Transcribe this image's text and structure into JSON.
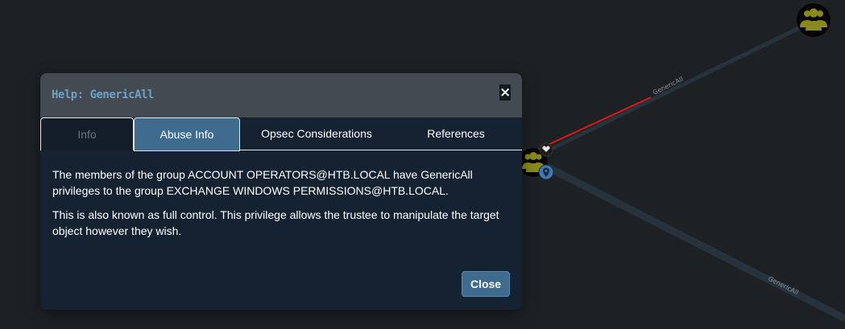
{
  "graph": {
    "edge_label_1": "GenericAll",
    "edge_label_2": "GenericAll",
    "colors": {
      "background": "#1e2124",
      "edge": "#26323c",
      "group_node": "#8a8a1c",
      "highlight_arrow": "#e01616",
      "pin_badge": "#3e78b2"
    },
    "icons": [
      "group-icon",
      "crown-icon",
      "map-pin-icon"
    ]
  },
  "modal": {
    "title": "Help: GenericAll",
    "close_icon": "×",
    "tabs": [
      "Info",
      "Abuse Info",
      "Opsec Considerations",
      "References"
    ],
    "active_tab": "Abuse Info",
    "paragraphs": [
      "The members of the group ACCOUNT OPERATORS@HTB.LOCAL have GenericAll privileges to the group EXCHANGE WINDOWS PERMISSIONS@HTB.LOCAL.",
      "This is also known as full control. This privilege allows the trustee to manipulate the target object however they wish."
    ],
    "close_button": "Close",
    "colors": {
      "header": "#434a51",
      "body": "#152232",
      "title": "#6ea0c4",
      "active_tab": "#3f6b8f",
      "button": "#3f6b8f"
    }
  }
}
